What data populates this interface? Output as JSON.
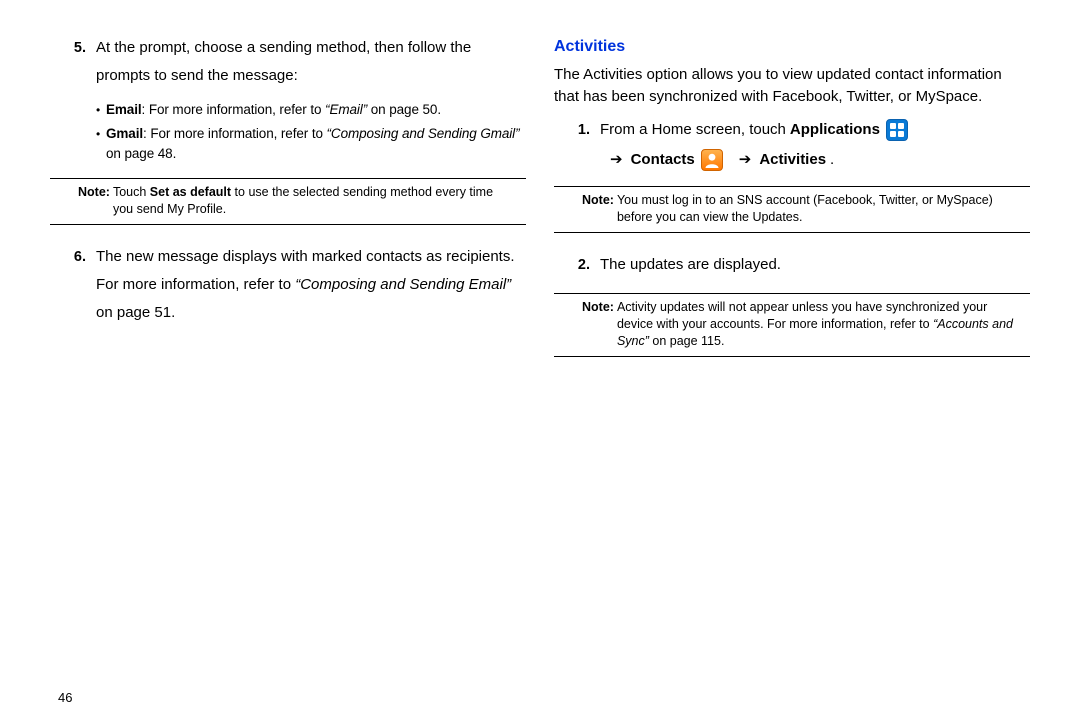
{
  "left": {
    "item5": {
      "num": "5.",
      "text": "At the prompt, choose a sending method, then follow the prompts to send the message:"
    },
    "bullet_email": {
      "label": "Email",
      "text_before": ": For more information, refer to ",
      "ref": "“Email”",
      "text_after": "  on page 50."
    },
    "bullet_gmail": {
      "label": "Gmail",
      "text_before": ": For more information, refer to ",
      "ref": "“Composing and Sending Gmail”",
      "text_after": "  on page 48."
    },
    "note1": {
      "label": "Note:",
      "pre": "Touch ",
      "strong": "Set as default",
      "post": " to use the selected sending method every time you send My Profile."
    },
    "item6": {
      "num": "6.",
      "text_pre": "The new message displays with marked contacts as recipients. For more information, refer to ",
      "ref": "“Composing and Sending Email”",
      "text_post": "  on page 51."
    }
  },
  "right": {
    "heading": "Activities",
    "intro": "The Activities option allows you to view updated contact information that has been synchronized with Facebook, Twitter, or MySpace.",
    "step1": {
      "num": "1.",
      "pre": "From a Home screen, touch ",
      "applications": "Applications",
      "contacts": "Contacts",
      "activities": "Activities"
    },
    "note2": {
      "label": "Note:",
      "text": "You must log in to an SNS account (Facebook, Twitter, or MySpace) before you can view the Updates."
    },
    "step2": {
      "num": "2.",
      "text": "The updates are displayed."
    },
    "note3": {
      "label": "Note:",
      "pre": "Activity updates will not appear unless you have synchronized your device with your accounts. For more information, refer to ",
      "ref": "“Accounts and Sync”",
      "post": "  on page 115."
    }
  },
  "page_number": "46"
}
